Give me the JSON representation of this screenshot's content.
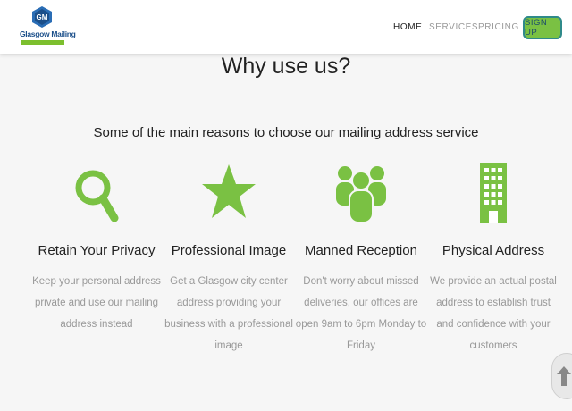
{
  "brand": {
    "name": "Glasgow Mailing",
    "initials": "GM"
  },
  "nav": {
    "home": "HOME",
    "services": "SERVICES",
    "pricing": "PRICING",
    "signup": "SIGN UP"
  },
  "section": {
    "title": "Why use us?",
    "subtitle": "Some of the main reasons to choose our mailing address service"
  },
  "features": [
    {
      "icon": "magnifier-icon",
      "title": "Retain Your Privacy",
      "description": "Keep your personal address private and use our mailing address instead"
    },
    {
      "icon": "star-icon",
      "title": "Professional Image",
      "description": "Get a Glasgow city center address providing your business with a professional image"
    },
    {
      "icon": "group-icon",
      "title": "Manned Reception",
      "description": "Don't worry about missed deliveries, our offices are open 9am to 6pm Monday to Friday"
    },
    {
      "icon": "building-icon",
      "title": "Physical Address",
      "description": "We provide an actual postal address to establish trust and confidence with your customers"
    }
  ],
  "colors": {
    "accent": "#7ac143",
    "brand_blue": "#1b4f8a",
    "muted_text": "#999999"
  }
}
